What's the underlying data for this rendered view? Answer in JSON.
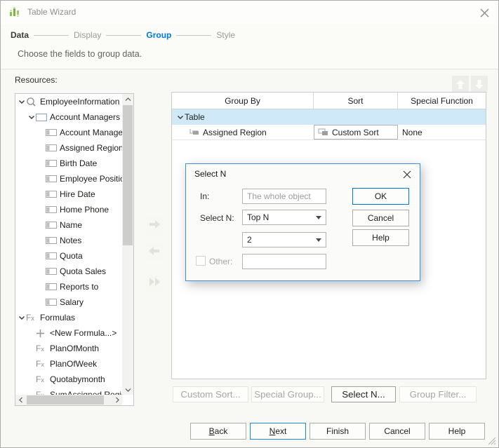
{
  "window": {
    "title": "Table Wizard"
  },
  "steps": {
    "items": [
      {
        "label": "Data",
        "state": "completed"
      },
      {
        "label": "Display",
        "state": "normal"
      },
      {
        "label": "Group",
        "state": "active"
      },
      {
        "label": "Style",
        "state": "normal"
      }
    ],
    "subtitle": "Choose the fields to group data."
  },
  "resources": {
    "label": "Resources:",
    "items": [
      {
        "label": "EmployeeInformation",
        "icon": "query-icon",
        "indent": 0,
        "chevron": true
      },
      {
        "label": "Account Managers",
        "icon": "table-icon",
        "indent": 1,
        "chevron": true
      },
      {
        "label": "Account Managers I",
        "icon": "column-icon",
        "indent": 2
      },
      {
        "label": "Assigned Region",
        "icon": "column-icon",
        "indent": 2
      },
      {
        "label": "Birth Date",
        "icon": "column-icon",
        "indent": 2
      },
      {
        "label": "Employee Position",
        "icon": "column-icon",
        "indent": 2
      },
      {
        "label": "Hire Date",
        "icon": "column-icon",
        "indent": 2
      },
      {
        "label": "Home Phone",
        "icon": "column-icon",
        "indent": 2
      },
      {
        "label": "Name",
        "icon": "column-icon",
        "indent": 2
      },
      {
        "label": "Notes",
        "icon": "column-icon",
        "indent": 2
      },
      {
        "label": "Quota",
        "icon": "column-icon",
        "indent": 2
      },
      {
        "label": "Quota Sales",
        "icon": "column-icon",
        "indent": 2
      },
      {
        "label": "Reports to",
        "icon": "column-icon",
        "indent": 2
      },
      {
        "label": "Salary",
        "icon": "column-icon",
        "indent": 2
      },
      {
        "label": "Formulas",
        "icon": "fx-icon",
        "indent": 0,
        "chevron": true
      },
      {
        "label": "<New Formula...>",
        "icon": "plus-icon",
        "indent": 1
      },
      {
        "label": "PlanOfMonth",
        "icon": "fx-icon",
        "indent": 1
      },
      {
        "label": "PlanOfWeek",
        "icon": "fx-icon",
        "indent": 1
      },
      {
        "label": "Quotabymonth",
        "icon": "fx-icon",
        "indent": 1
      },
      {
        "label": "SumAssigned Region",
        "icon": "fx-icon",
        "indent": 1
      }
    ]
  },
  "transfer_buttons": [
    {
      "name": "add-field-button",
      "icon": "right-arrow-icon"
    },
    {
      "name": "remove-field-button",
      "icon": "left-arrow-icon"
    },
    {
      "name": "add-all-fields-button",
      "icon": "double-right-arrow-icon"
    }
  ],
  "group_table": {
    "columns": [
      "Group By",
      "Sort",
      "Special Function"
    ],
    "rows": [
      {
        "selected": true,
        "cells": [
          {
            "text": "Table",
            "chevron": true,
            "indent": 0
          },
          {
            "text": ""
          },
          {
            "text": ""
          }
        ]
      },
      {
        "selected": false,
        "cells": [
          {
            "text": "Assigned Region",
            "icon": "group-node-icon",
            "indent": 1
          },
          {
            "text": "Custom Sort",
            "icon": "custom-sort-icon",
            "boxed": true
          },
          {
            "text": "None"
          }
        ]
      }
    ]
  },
  "action_buttons": [
    {
      "label": "Custom Sort...",
      "enabled": false
    },
    {
      "label": "Special Group...",
      "enabled": false
    },
    {
      "label": "Select N...",
      "enabled": true
    },
    {
      "label": "Group Filter...",
      "enabled": false
    }
  ],
  "select_n_dialog": {
    "title": "Select N",
    "in_label": "In:",
    "in_value": "The whole object",
    "select_n_label": "Select N:",
    "select_n_value": "Top N",
    "n_value": "2",
    "other_label": "Other:",
    "other_value": "",
    "other_checked": false,
    "buttons": [
      {
        "label": "OK",
        "default": true
      },
      {
        "label": "Cancel",
        "default": false
      },
      {
        "label": "Help",
        "default": false
      }
    ]
  },
  "footer_buttons": [
    {
      "label": "Back",
      "accesskey": true,
      "default": false
    },
    {
      "label": "Next",
      "accesskey": true,
      "default": true
    },
    {
      "label": "Finish",
      "accesskey": false,
      "default": false
    },
    {
      "label": "Cancel",
      "accesskey": false,
      "default": false
    },
    {
      "label": "Help",
      "accesskey": false,
      "default": false
    }
  ],
  "colors": {
    "accent": "#0078d7",
    "selection": "#cfe9f8",
    "brand_green": "#8bc34a"
  }
}
